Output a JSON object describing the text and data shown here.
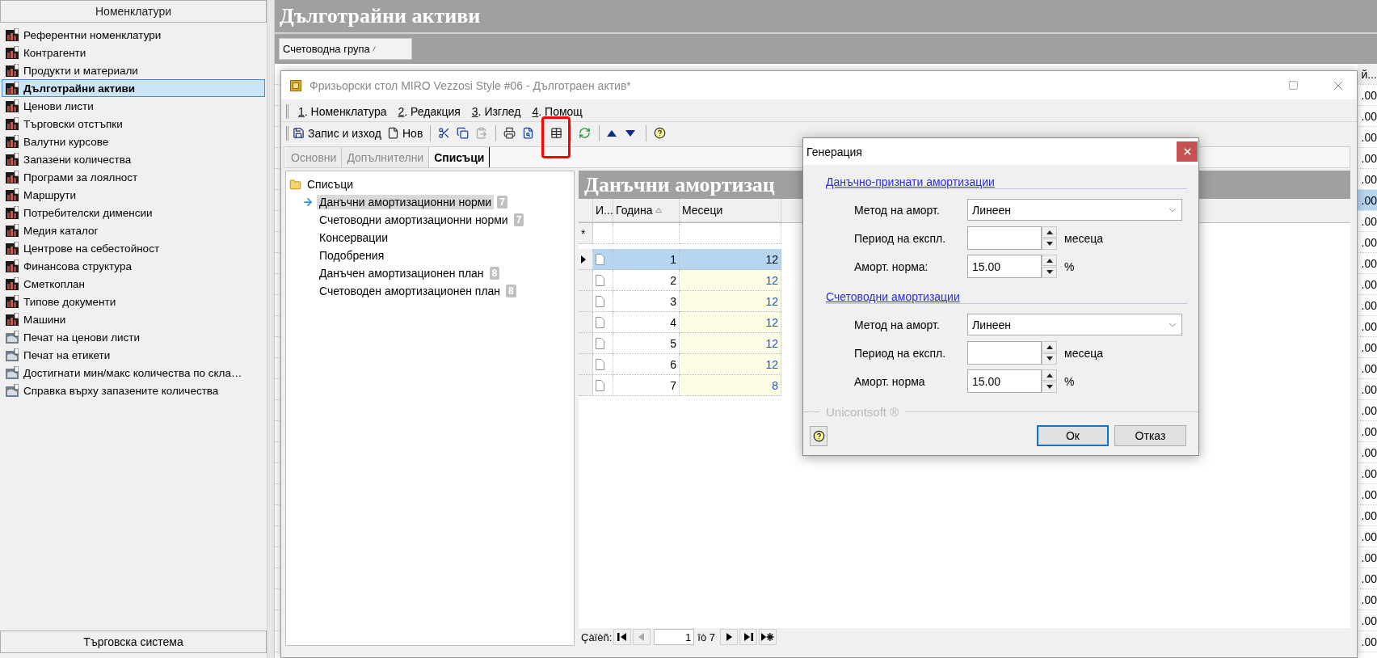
{
  "sidebar": {
    "title": "Номенклатури",
    "items": [
      {
        "label": "Референтни номенклатури",
        "kind": "module",
        "selected": false
      },
      {
        "label": "Контрагенти",
        "kind": "module",
        "selected": false
      },
      {
        "label": "Продукти и материали",
        "kind": "module",
        "selected": false
      },
      {
        "label": "Дълготрайни активи",
        "kind": "module",
        "selected": true
      },
      {
        "label": "Ценови листи",
        "kind": "module",
        "selected": false
      },
      {
        "label": "Търговски отстъпки",
        "kind": "module",
        "selected": false
      },
      {
        "label": "Валутни курсове",
        "kind": "module",
        "selected": false
      },
      {
        "label": "Запазени количества",
        "kind": "module",
        "selected": false
      },
      {
        "label": "Програми за лоялност",
        "kind": "module",
        "selected": false
      },
      {
        "label": "Маршрути",
        "kind": "module",
        "selected": false
      },
      {
        "label": "Потребителски дименсии",
        "kind": "module",
        "selected": false
      },
      {
        "label": "Медия каталог",
        "kind": "module",
        "selected": false
      },
      {
        "label": "Центрове на себестойност",
        "kind": "module",
        "selected": false
      },
      {
        "label": "Финансова структура",
        "kind": "module",
        "selected": false
      },
      {
        "label": "Сметкоплан",
        "kind": "module",
        "selected": false
      },
      {
        "label": "Типове документи",
        "kind": "module",
        "selected": false
      },
      {
        "label": "Машини",
        "kind": "module",
        "selected": false
      },
      {
        "label": "Печат на ценови листи",
        "kind": "report",
        "selected": false
      },
      {
        "label": "Печат на етикети",
        "kind": "report",
        "selected": false
      },
      {
        "label": "Достигнати мин/макс количества по скла…",
        "kind": "report",
        "selected": false
      },
      {
        "label": "Справка върху запазените количества",
        "kind": "report",
        "selected": false
      }
    ],
    "footer": "Търговска система"
  },
  "main": {
    "title": "Дълготрайни активи",
    "group_column": "Счетоводна група",
    "grid": {
      "column": "й...",
      "rows": [
        {
          "value": ".00",
          "selected": false
        },
        {
          "value": ".00",
          "selected": false
        },
        {
          "value": ".00",
          "selected": false
        },
        {
          "value": ".00",
          "selected": false
        },
        {
          "value": ".00",
          "selected": false
        },
        {
          "value": ".00",
          "selected": true
        },
        {
          "value": ".00",
          "selected": false
        },
        {
          "value": ".00",
          "selected": false
        },
        {
          "value": ".00",
          "selected": false
        },
        {
          "value": ".00",
          "selected": false
        },
        {
          "value": ".00",
          "selected": false
        },
        {
          "value": ".00",
          "selected": false
        },
        {
          "value": ".00",
          "selected": false
        },
        {
          "value": ".00",
          "selected": false
        },
        {
          "value": ".00",
          "selected": false
        },
        {
          "value": ".00",
          "selected": false
        },
        {
          "value": ".00",
          "selected": false
        },
        {
          "value": ".00",
          "selected": false
        },
        {
          "value": ".00",
          "selected": false
        },
        {
          "value": ".00",
          "selected": false
        },
        {
          "value": ".00",
          "selected": false
        },
        {
          "value": ".00",
          "selected": false
        },
        {
          "value": ".00",
          "selected": false
        },
        {
          "value": ".00",
          "selected": false
        },
        {
          "value": ".00",
          "selected": false
        },
        {
          "value": ".00",
          "selected": false
        },
        {
          "value": ".00",
          "selected": false
        }
      ]
    }
  },
  "window": {
    "title": "Фризьорски стол MIRO Vezzosi Style #06 - Дълготраен актив*",
    "menu": [
      {
        "accel": "1",
        "label": ". Номенклатура"
      },
      {
        "accel": "2",
        "label": ". Редакция"
      },
      {
        "accel": "3",
        "label": ". Изглед"
      },
      {
        "accel": "4",
        "label": ". Помощ"
      }
    ],
    "toolbar": [
      {
        "kind": "save",
        "label": "Запис и изход",
        "disabled": false,
        "highlighted": false
      },
      {
        "kind": "new",
        "label": "Нов",
        "disabled": false,
        "highlighted": false
      },
      {
        "kind": "separator"
      },
      {
        "kind": "cut",
        "disabled": false,
        "highlighted": false
      },
      {
        "kind": "copy",
        "disabled": false,
        "highlighted": false
      },
      {
        "kind": "paste",
        "disabled": true,
        "highlighted": false
      },
      {
        "kind": "separator"
      },
      {
        "kind": "print",
        "disabled": false,
        "highlighted": false
      },
      {
        "kind": "preview",
        "disabled": false,
        "highlighted": false
      },
      {
        "kind": "separator"
      },
      {
        "kind": "generate",
        "disabled": false,
        "highlighted": true
      },
      {
        "kind": "separator"
      },
      {
        "kind": "refresh",
        "disabled": false,
        "highlighted": false
      },
      {
        "kind": "separator"
      },
      {
        "kind": "up",
        "disabled": false,
        "highlighted": false
      },
      {
        "kind": "down",
        "disabled": false,
        "highlighted": false
      },
      {
        "kind": "separator"
      },
      {
        "kind": "help",
        "disabled": false,
        "highlighted": false
      }
    ],
    "tabs": [
      {
        "label": "Основни",
        "selected": false
      },
      {
        "label": "Допълнителни",
        "selected": false
      },
      {
        "label": "Списъци",
        "selected": true
      }
    ],
    "tree": {
      "label": "Списъци",
      "children": [
        {
          "label": "Данъчни амортизационни норми",
          "badge": "7",
          "selected": true
        },
        {
          "label": "Счетоводни амортизационни норми",
          "badge": "7",
          "selected": false
        },
        {
          "label": "Консервации",
          "selected": false
        },
        {
          "label": "Подобрения",
          "selected": false
        },
        {
          "label": "Данъчен амортизационен план",
          "badge": "8",
          "selected": false
        },
        {
          "label": "Счетоводен амортизационен план",
          "badge": "8",
          "selected": false
        }
      ]
    },
    "grid": {
      "title": "Данъчни амортизац",
      "columns": [
        "И...",
        "Година",
        "Месеци"
      ],
      "new_row_marker": "*",
      "rows": [
        {
          "year": "1",
          "months": "12",
          "selected": true
        },
        {
          "year": "2",
          "months": "12",
          "selected": false
        },
        {
          "year": "3",
          "months": "12",
          "selected": false
        },
        {
          "year": "4",
          "months": "12",
          "selected": false
        },
        {
          "year": "5",
          "months": "12",
          "selected": false
        },
        {
          "year": "6",
          "months": "12",
          "selected": false
        },
        {
          "year": "7",
          "months": "8",
          "selected": false
        }
      ]
    },
    "navigator": {
      "label": "Çàïèñ:",
      "record": "1",
      "total": "îò 7",
      "buttons": [
        {
          "kind": "first",
          "disabled": false
        },
        {
          "kind": "prev",
          "disabled": true
        },
        {
          "kind": "next",
          "disabled": false
        },
        {
          "kind": "last",
          "disabled": false
        },
        {
          "kind": "new",
          "disabled": false
        }
      ]
    }
  },
  "dialog": {
    "title": "Генерация",
    "sections": [
      {
        "heading": "Данъчно-признати амортизации",
        "fields": [
          {
            "kind": "combo",
            "label": "Метод на аморт.",
            "value": "Линеен"
          },
          {
            "kind": "spin",
            "label": "Период на експл.",
            "unit": "месеца"
          },
          {
            "kind": "spin",
            "label": "Аморт. норма:",
            "value": "15.00",
            "unit": "%"
          }
        ]
      },
      {
        "heading": "Счетоводни амортизации",
        "fields": [
          {
            "kind": "combo",
            "label": "Метод на аморт.",
            "value": "Линеен"
          },
          {
            "kind": "spin",
            "label": "Период на експл.",
            "unit": "месеца"
          },
          {
            "kind": "spin",
            "label": "Аморт. норма",
            "value": "15.00",
            "unit": "%"
          }
        ]
      }
    ],
    "brand": "Unicontsoft ®",
    "buttons": [
      {
        "label": "Ок",
        "default": true
      },
      {
        "label": "Отказ",
        "default": false
      }
    ]
  }
}
